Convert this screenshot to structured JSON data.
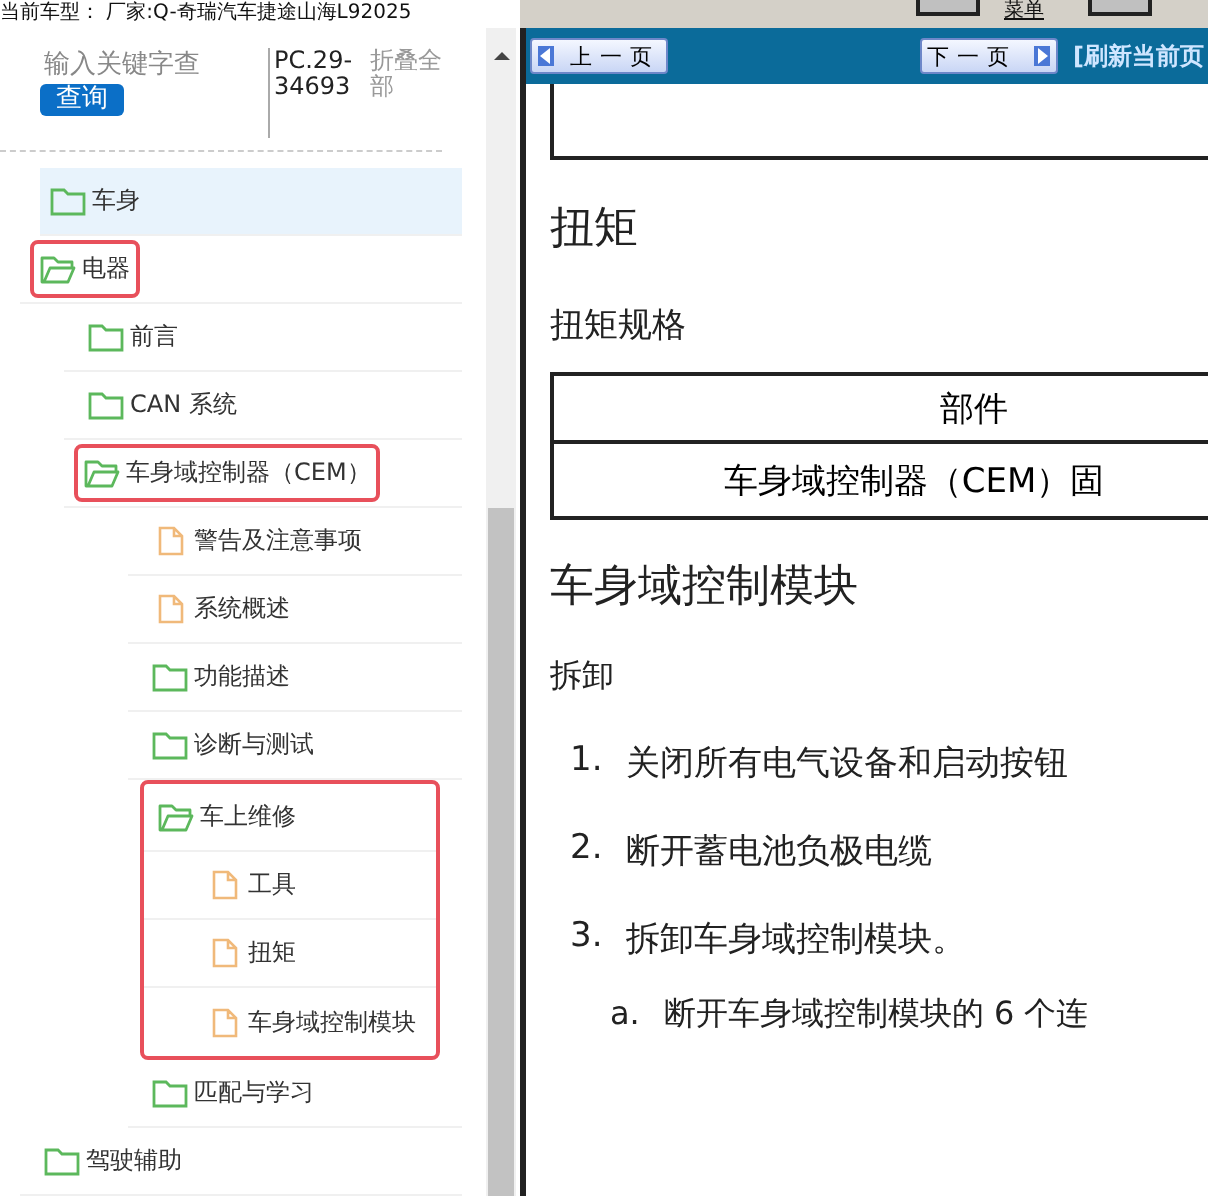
{
  "vehicle_line": "当前车型： 厂家:Q-奇瑞汽车捷途山海L92025",
  "toolbar": {
    "menu_link": "菜单"
  },
  "sidebar": {
    "search": {
      "placeholder": "输入关键字查"
    },
    "search_button": "查询",
    "code": "PC.29-34693",
    "collapse_all": "折叠全部",
    "tree": [
      {
        "label": "车身",
        "kind": "folder",
        "expanded": false,
        "selected": true,
        "highlighted": false
      },
      {
        "label": "电器",
        "kind": "folder",
        "expanded": true,
        "selected": false,
        "highlighted": true,
        "children": [
          {
            "label": "前言",
            "kind": "folder",
            "expanded": false,
            "selected": false,
            "highlighted": false
          },
          {
            "label": "CAN 系统",
            "kind": "folder",
            "expanded": false,
            "selected": false,
            "highlighted": false
          },
          {
            "label": "车身域控制器（CEM）",
            "kind": "folder",
            "expanded": true,
            "selected": false,
            "highlighted": true,
            "children": [
              {
                "label": "警告及注意事项",
                "kind": "page",
                "selected": false,
                "highlighted": false
              },
              {
                "label": "系统概述",
                "kind": "page",
                "selected": false,
                "highlighted": false
              },
              {
                "label": "功能描述",
                "kind": "folder",
                "expanded": false,
                "selected": false,
                "highlighted": false
              },
              {
                "label": "诊断与测试",
                "kind": "folder",
                "expanded": false,
                "selected": false,
                "highlighted": false
              },
              {
                "label": "车上维修",
                "kind": "folder",
                "expanded": true,
                "selected": false,
                "highlighted": true,
                "children": [
                  {
                    "label": "工具",
                    "kind": "page",
                    "selected": false,
                    "highlighted": true
                  },
                  {
                    "label": "扭矩",
                    "kind": "page",
                    "selected": false,
                    "highlighted": true
                  },
                  {
                    "label": "车身域控制模块",
                    "kind": "page",
                    "selected": false,
                    "highlighted": true
                  }
                ]
              },
              {
                "label": "匹配与学习",
                "kind": "folder",
                "expanded": false,
                "selected": false,
                "highlighted": false
              }
            ]
          }
        ]
      },
      {
        "label": "驾驶辅助",
        "kind": "folder",
        "expanded": false,
        "selected": false,
        "highlighted": false
      }
    ]
  },
  "nav": {
    "prev": "上一页",
    "next": "下一页",
    "refresh": "[刷新当前页"
  },
  "document": {
    "title": "扭矩",
    "subtitle": "扭矩规格",
    "table": {
      "columns": [
        "部件"
      ],
      "rows": [
        [
          "车身域控制器（CEM）固"
        ]
      ]
    },
    "section_title": "车身域控制模块",
    "procedure_title": "拆卸",
    "steps": [
      {
        "marker": "1.",
        "text": "关闭所有电气设备和启动按钮"
      },
      {
        "marker": "2.",
        "text": "断开蓄电池负极电缆"
      },
      {
        "marker": "3.",
        "text": "拆卸车身域控制模块。",
        "children": [
          {
            "marker": "a.",
            "text": "断开车身域控制模块的 6 个连"
          }
        ]
      }
    ]
  }
}
